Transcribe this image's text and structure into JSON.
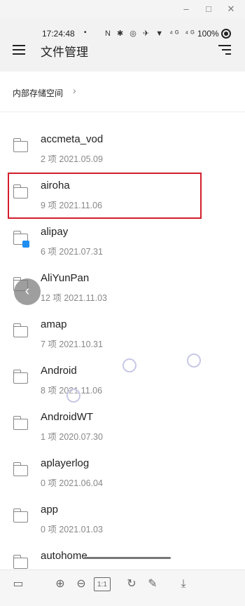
{
  "window": {
    "minimize_glyph": "–",
    "maximize_glyph": "□",
    "close_glyph": "✕"
  },
  "status_bar": {
    "time": "17:24:48",
    "dot": "•",
    "icons_text": "N ✱ ◎ ✈ ▼ ⁴ᴳ ⁴ᴳ",
    "battery": "100%"
  },
  "header": {
    "title": "文件管理",
    "menu_icon": "hamburger-icon",
    "sort_icon": "sort-icon"
  },
  "breadcrumb": {
    "label": "内部存储空间",
    "chevron": "›"
  },
  "files": [
    {
      "name": "accmeta_vod",
      "meta": "2 项  2021.05.09"
    },
    {
      "name": "airoha",
      "meta": "9 项  2021.11.06"
    },
    {
      "name": "alipay",
      "meta": "6 项  2021.07.31",
      "badge": true
    },
    {
      "name": "AliYunPan",
      "meta": "12 项  2021.11.03"
    },
    {
      "name": "amap",
      "meta": "7 项  2021.10.31"
    },
    {
      "name": "Android",
      "meta": "8 项  2021.11.06"
    },
    {
      "name": "AndroidWT",
      "meta": "1 项  2020.07.30"
    },
    {
      "name": "aplayerlog",
      "meta": "0 项  2021.06.04"
    },
    {
      "name": "app",
      "meta": "0 项  2021.01.03"
    },
    {
      "name": "autohome",
      "meta": ""
    }
  ],
  "highlight_color": "#d21e2b",
  "overlay": {
    "back_glyph": "‹"
  },
  "toolbar": {
    "page_glyph": "▭",
    "zoom_in_glyph": "⊕",
    "zoom_out_glyph": "⊖",
    "fit_label": "1:1",
    "rotate_glyph": "↻",
    "edit_glyph": "✎",
    "download_glyph": "⤓"
  }
}
